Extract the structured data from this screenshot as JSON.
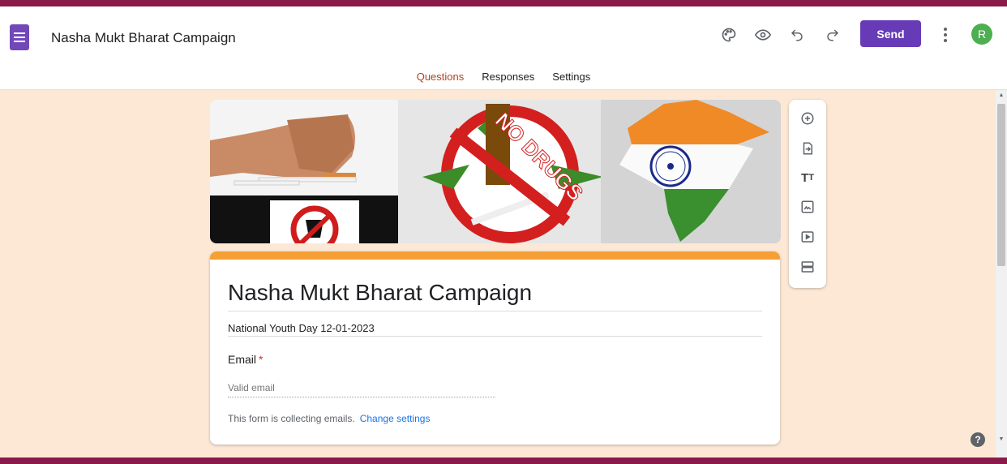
{
  "header": {
    "doc_title": "Nasha Mukt Bharat Campaign",
    "send_label": "Send",
    "avatar_letter": "R",
    "icons": [
      "palette-icon",
      "preview-eye-icon",
      "undo-icon",
      "redo-icon",
      "more-vert-icon"
    ]
  },
  "tabs": [
    {
      "label": "Questions",
      "active": true
    },
    {
      "label": "Responses",
      "active": false
    },
    {
      "label": "Settings",
      "active": false
    }
  ],
  "form": {
    "title": "Nasha Mukt Bharat Campaign",
    "description": "National Youth Day 12-01-2023",
    "question_label": "Email",
    "required_mark": "*",
    "email_placeholder": "Valid email",
    "collect_notice": "This form is collecting emails.",
    "change_settings_label": "Change settings"
  },
  "banner": {
    "no_drugs_text": "NO DRUGS"
  },
  "side_toolbar": [
    "add-question-icon",
    "import-questions-icon",
    "add-title-icon",
    "add-image-icon",
    "add-video-icon",
    "add-section-icon"
  ],
  "colors": {
    "accent": "#673ab7",
    "theme_bg": "#fce8d5",
    "card_top": "#f5a035",
    "active_tab": "#b0451d",
    "border": "#8a1a4a"
  }
}
